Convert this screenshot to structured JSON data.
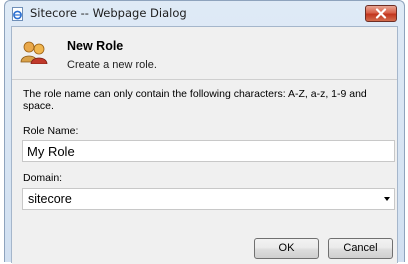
{
  "window": {
    "title": "Sitecore -- Webpage Dialog"
  },
  "header": {
    "title": "New Role",
    "subtitle": "Create a new role."
  },
  "form": {
    "description": "The role name can only contain the following characters: A-Z, a-z, 1-9 and space.",
    "role_name_label": "Role Name:",
    "role_name_value": "My Role",
    "domain_label": "Domain:",
    "domain_value": "sitecore"
  },
  "buttons": {
    "ok_label": "OK",
    "cancel_label": "Cancel"
  },
  "icons": {
    "title_icon": "ie-page-icon",
    "header_icon": "role-users-icon",
    "close_icon": "close-icon",
    "dropdown_icon": "chevron-down-icon"
  },
  "colors": {
    "close_button": "#c2361e",
    "titlebar": "#d1e0f1"
  }
}
